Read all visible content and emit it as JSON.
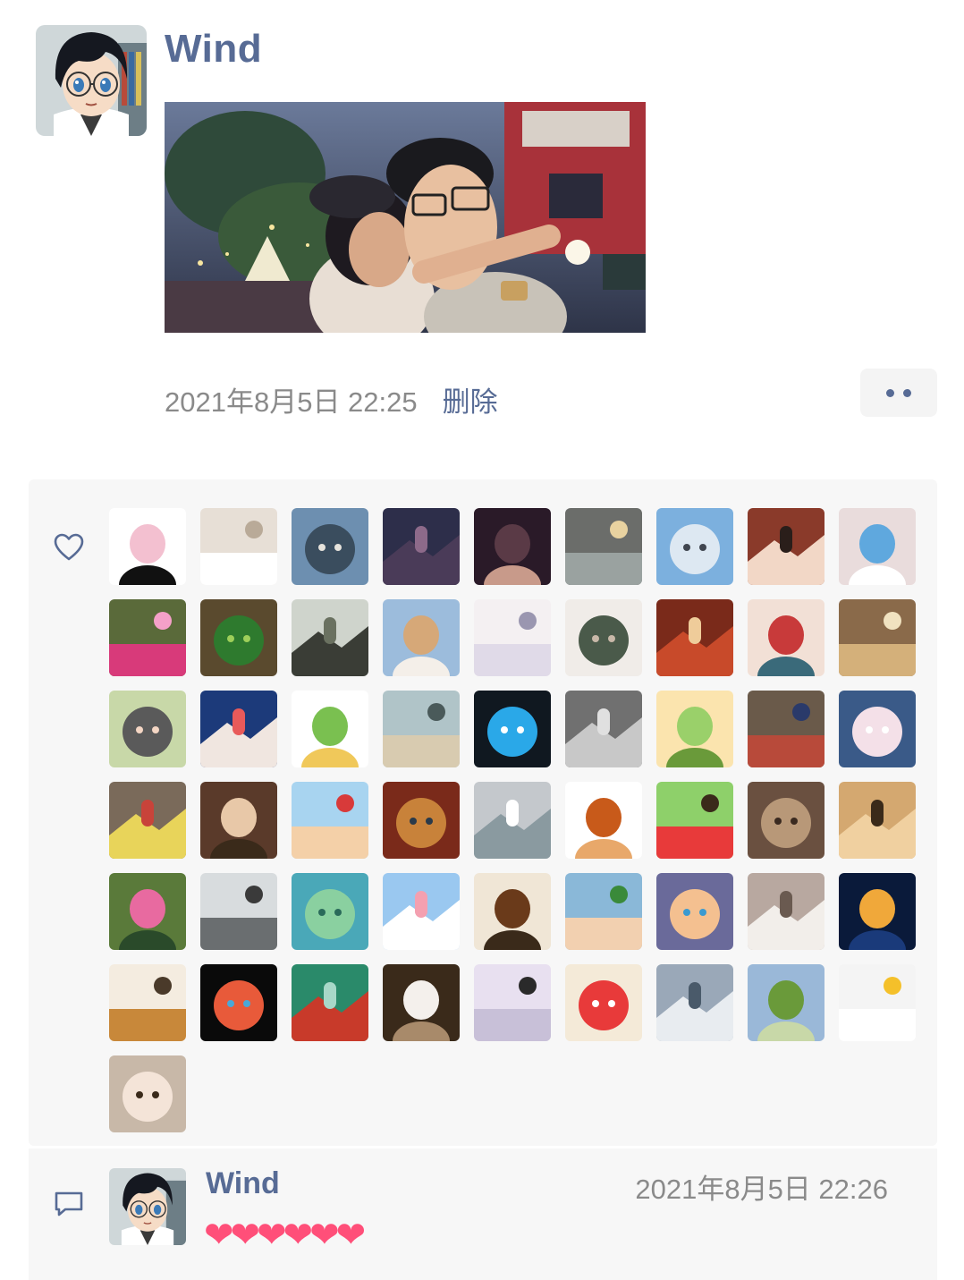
{
  "post": {
    "author": "Wind",
    "timestamp": "2021年8月5日 22:25",
    "delete_label": "删除"
  },
  "likes": {
    "icon": "heart-outline-icon",
    "avatars": [
      {
        "c1": "#ffffff",
        "c2": "#f3c0d0",
        "c3": "#111111"
      },
      {
        "c1": "#e7dfd6",
        "c2": "#ffffff",
        "c3": "#b9aa98"
      },
      {
        "c1": "#6d8fb0",
        "c2": "#3a4d5e",
        "c3": "#e6e3dc"
      },
      {
        "c1": "#2d2e4a",
        "c2": "#4a3b58",
        "c3": "#8d6a8a"
      },
      {
        "c1": "#2a1a28",
        "c2": "#5a3a46",
        "c3": "#c89a8a"
      },
      {
        "c1": "#6b6d6a",
        "c2": "#9aa2a0",
        "c3": "#e8d2a0"
      },
      {
        "c1": "#7cb0de",
        "c2": "#dde8f2",
        "c3": "#404650"
      },
      {
        "c1": "#8a3a2a",
        "c2": "#f2d7c6",
        "c3": "#2a1e1a"
      },
      {
        "c1": "#e9dcdc",
        "c2": "#5fa8de",
        "c3": "#ffffff"
      },
      {
        "c1": "#5a6a3a",
        "c2": "#d83a7a",
        "c3": "#f4a0c8"
      },
      {
        "c1": "#5a4a2e",
        "c2": "#2e7a2e",
        "c3": "#9ecf5a"
      },
      {
        "c1": "#cfd4cc",
        "c2": "#3a3d36",
        "c3": "#6a7160"
      },
      {
        "c1": "#9cbcdc",
        "c2": "#d6a878",
        "c3": "#f4efe9"
      },
      {
        "c1": "#f4f0f2",
        "c2": "#e0dae8",
        "c3": "#9a96b0"
      },
      {
        "c1": "#f0ece8",
        "c2": "#4a5a4a",
        "c3": "#c8b8a8"
      },
      {
        "c1": "#7a2a1a",
        "c2": "#c84a2a",
        "c3": "#efcc9a"
      },
      {
        "c1": "#f2e0d6",
        "c2": "#c83a3a",
        "c3": "#3a6a7a"
      },
      {
        "c1": "#8a6a4a",
        "c2": "#d4b07a",
        "c3": "#f0e2c0"
      },
      {
        "c1": "#c8d8a8",
        "c2": "#5a5a5a",
        "c3": "#f4d6c4"
      },
      {
        "c1": "#1c3a7a",
        "c2": "#f0e6e0",
        "c3": "#e85a5a"
      },
      {
        "c1": "#ffffff",
        "c2": "#7ac050",
        "c3": "#f0c85a"
      },
      {
        "c1": "#b0c4c8",
        "c2": "#d8cbb0",
        "c3": "#4a5a5a"
      },
      {
        "c1": "#101820",
        "c2": "#2aa8e8",
        "c3": "#ffffff"
      },
      {
        "c1": "#707070",
        "c2": "#c8c8c8",
        "c3": "#e0e0e0"
      },
      {
        "c1": "#fbe4ae",
        "c2": "#9ad06a",
        "c3": "#6a9a3a"
      },
      {
        "c1": "#6a5a4a",
        "c2": "#b84a3a",
        "c3": "#2a3a6a"
      },
      {
        "c1": "#3a5a88",
        "c2": "#f4e0e8",
        "c3": "#ffffff"
      },
      {
        "c1": "#7a6a5a",
        "c2": "#e8d45a",
        "c3": "#c8433a"
      },
      {
        "c1": "#5a3a2a",
        "c2": "#e8c8a8",
        "c3": "#3a2a1a"
      },
      {
        "c1": "#a8d4f0",
        "c2": "#f4d0a8",
        "c3": "#d83a3a"
      },
      {
        "c1": "#7a2a1a",
        "c2": "#c8823a",
        "c3": "#2a3a4a"
      },
      {
        "c1": "#c4c8cc",
        "c2": "#8a9aa0",
        "c3": "#ffffff"
      },
      {
        "c1": "#ffffff",
        "c2": "#c85a1a",
        "c3": "#e8a86a"
      },
      {
        "c1": "#8ed06a",
        "c2": "#e83a3a",
        "c3": "#3a2a1a"
      },
      {
        "c1": "#6a5040",
        "c2": "#b89878",
        "c3": "#3a2a20"
      },
      {
        "c1": "#d4a870",
        "c2": "#f0d0a0",
        "c3": "#3a2a1a"
      },
      {
        "c1": "#5a7a3a",
        "c2": "#e86aa0",
        "c3": "#2a4a2a"
      },
      {
        "c1": "#d8dcde",
        "c2": "#6a6e70",
        "c3": "#3a3a3a"
      },
      {
        "c1": "#4aa8b8",
        "c2": "#8ad0a0",
        "c3": "#2a6a5a"
      },
      {
        "c1": "#9ac8f0",
        "c2": "#ffffff",
        "c3": "#f4a0b0"
      },
      {
        "c1": "#f0e6d6",
        "c2": "#6a3a1a",
        "c3": "#3a2a1a"
      },
      {
        "c1": "#8ab8d8",
        "c2": "#f2d0b0",
        "c3": "#3a8a3a"
      },
      {
        "c1": "#6a6a9a",
        "c2": "#f4c090",
        "c3": "#3a9ad0"
      },
      {
        "c1": "#b8a8a0",
        "c2": "#f2eeea",
        "c3": "#6a5a50"
      },
      {
        "c1": "#0a1a3a",
        "c2": "#f0a83a",
        "c3": "#1a3a7a"
      },
      {
        "c1": "#f4ece0",
        "c2": "#c8883a",
        "c3": "#4a3a2a"
      },
      {
        "c1": "#0a0a0a",
        "c2": "#e85a3a",
        "c3": "#4aa8d8"
      },
      {
        "c1": "#2a8a6a",
        "c2": "#c83a2a",
        "c3": "#a8d8c8"
      },
      {
        "c1": "#3a2a1a",
        "c2": "#f4f0ec",
        "c3": "#a88a6a"
      },
      {
        "c1": "#e8e0f0",
        "c2": "#c8c0d8",
        "c3": "#2a2a2a"
      },
      {
        "c1": "#f4ead8",
        "c2": "#e83a3a",
        "c3": "#ffffff"
      },
      {
        "c1": "#9aa8b8",
        "c2": "#e8ecf0",
        "c3": "#4a5a6a"
      },
      {
        "c1": "#9ab8d8",
        "c2": "#6a9a3a",
        "c3": "#c8d8a8"
      },
      {
        "c1": "#f4f4f4",
        "c2": "#ffffff",
        "c3": "#f4c02a"
      },
      {
        "c1": "#c8b8a8",
        "c2": "#f4e4d8",
        "c3": "#3a2a1a"
      }
    ]
  },
  "comment": {
    "icon": "comment-bubble-icon",
    "author": "Wind",
    "timestamp": "2021年8月5日 22:26",
    "text": "❤❤❤❤❤❤"
  },
  "colors": {
    "link": "#576b95",
    "meta": "#8a8a8a",
    "panel": "#f7f7f7",
    "heart": "#ff4f79"
  }
}
